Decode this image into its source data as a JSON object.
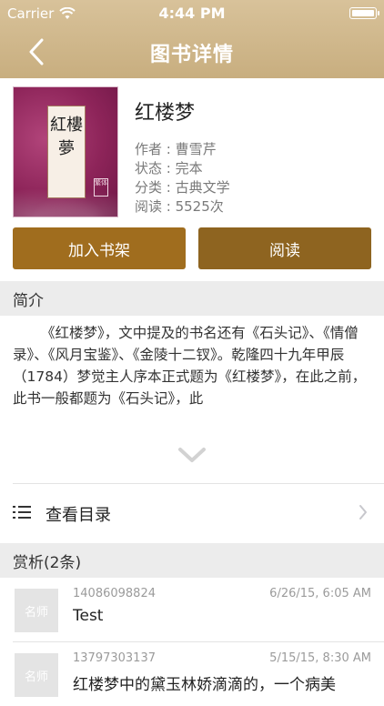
{
  "status_bar": {
    "carrier": "Carrier",
    "time": "4:44 PM"
  },
  "nav": {
    "title": "图书详情"
  },
  "book": {
    "cover_title": "紅樓夢",
    "cover_seal": "繁体",
    "title": "红楼梦",
    "author": "作者 : 曹雪芹",
    "status": "状态 : 完本",
    "category": "分类 : 古典文学",
    "reads": "阅读 : 5525次"
  },
  "actions": {
    "add_shelf": "加入书架",
    "read": "阅读"
  },
  "intro": {
    "header": "简介",
    "text": "《红楼梦》，文中提及的书名还有《石头记》、《情僧录》、《风月宝鉴》、《金陵十二钗》。乾隆四十九年甲辰（1784）梦觉主人序本正式题为《红楼梦》，在此之前，此书一般都题为《石头记》，此"
  },
  "catalog": {
    "label": "查看目录"
  },
  "reviews": {
    "header": "赏析(2条)",
    "items": [
      {
        "avatar_text": "名师",
        "user": "14086098824",
        "date": "6/26/15, 6:05 AM",
        "text": "Test"
      },
      {
        "avatar_text": "名师",
        "user": "13797303137",
        "date": "5/15/15, 8:30 AM",
        "text": "红楼梦中的黛玉林娇滴滴的，一个病美"
      }
    ]
  },
  "colors": {
    "header": "#c8ae7f",
    "button": "#9a6a1e"
  }
}
